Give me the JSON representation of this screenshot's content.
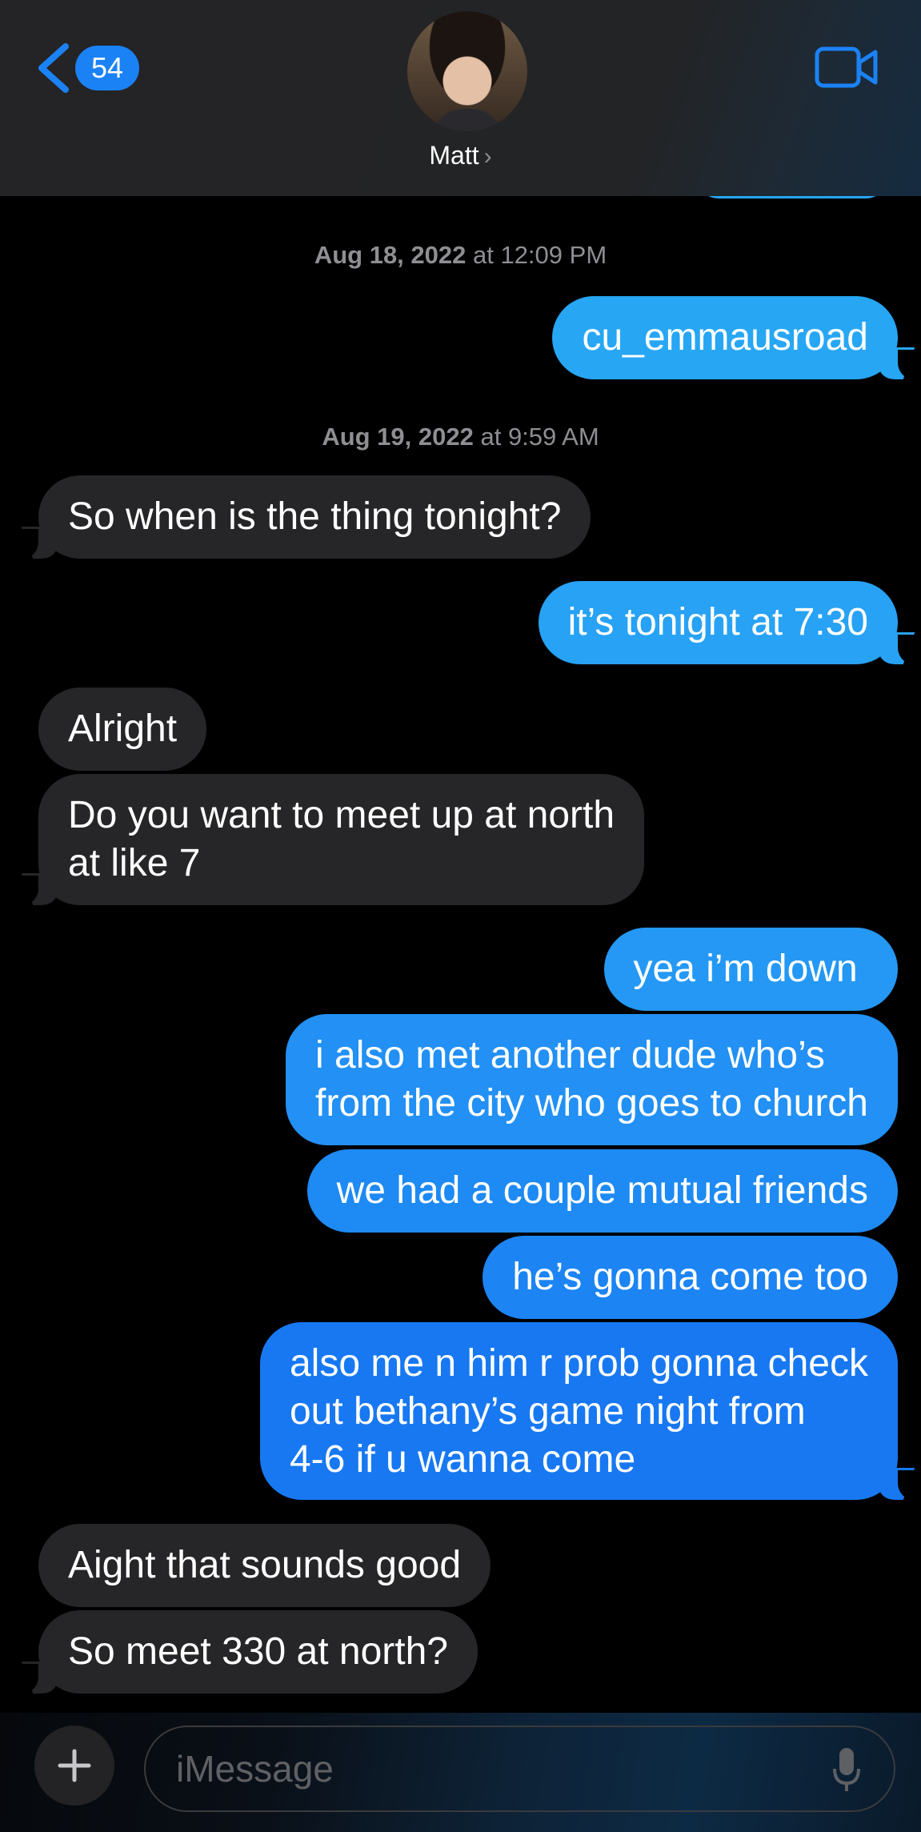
{
  "header": {
    "back_badge": "54",
    "contact_name": "Matt",
    "contact_chevron": "›"
  },
  "colors": {
    "outgoing_top": "#27a6f4",
    "outgoing_bottom": "#1778f2",
    "incoming": "#262628",
    "accent": "#1b82f5"
  },
  "thread": {
    "ts1_date": "Aug 18, 2022",
    "ts1_time": " at 12:09 PM",
    "ts2_date": "Aug 19, 2022",
    "ts2_time": " at 9:59 AM",
    "messages": [
      {
        "dir": "out",
        "text": "cu_emmausroad"
      },
      {
        "dir": "in",
        "text": "So when is the thing tonight?"
      },
      {
        "dir": "out",
        "text": "it’s tonight at 7:30"
      },
      {
        "dir": "in",
        "text": "Alright"
      },
      {
        "dir": "in",
        "text": "Do you want to meet up at north\nat like 7"
      },
      {
        "dir": "out",
        "text": "yea i’m down "
      },
      {
        "dir": "out",
        "text": "i also met another dude who’s\nfrom the city who goes to church"
      },
      {
        "dir": "out",
        "text": "we had a couple mutual friends"
      },
      {
        "dir": "out",
        "text": "he’s gonna come too"
      },
      {
        "dir": "out",
        "text": "also me n him r prob gonna check\nout bethany’s game night from\n4-6 if u wanna come"
      },
      {
        "dir": "in",
        "text": "Aight that sounds good"
      },
      {
        "dir": "in",
        "text": "So meet 330 at north?"
      }
    ]
  },
  "compose": {
    "placeholder": "iMessage"
  },
  "icons": [
    "back-chevron-icon",
    "video-camera-icon",
    "plus-icon",
    "microphone-icon"
  ]
}
